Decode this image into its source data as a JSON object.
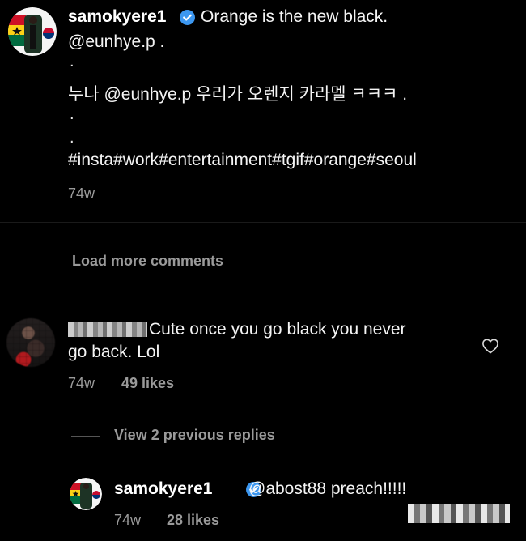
{
  "post": {
    "username": "samokyere1",
    "caption_line1": "Orange is the new black.",
    "caption_mention": "@eunhye.p .",
    "dot_a": ".",
    "korean_line": "누나 @eunhye.p  우리가 오렌지 카라멜 ㅋㅋㅋ .",
    "dot_b": ".",
    "dot_c": ".",
    "hashtags": "#insta#work#entertainment#tgif#orange#seoul",
    "time": "74w"
  },
  "load_more": "Load more comments",
  "comment": {
    "text_line1": "Cute once you go black you never",
    "text_line2": "go back. Lol",
    "time": "74w",
    "likes": "49 likes"
  },
  "view_replies": "View 2 previous replies",
  "reply": {
    "username": "samokyere1",
    "text": "@abost88 preach!!!!!",
    "time": "74w",
    "likes": "28 likes"
  },
  "colors": {
    "background": "#000000",
    "verified": "#3c97f0",
    "muted_text": "#9a9a9a"
  },
  "icons": [
    "verified-badge-icon",
    "heart-icon"
  ]
}
